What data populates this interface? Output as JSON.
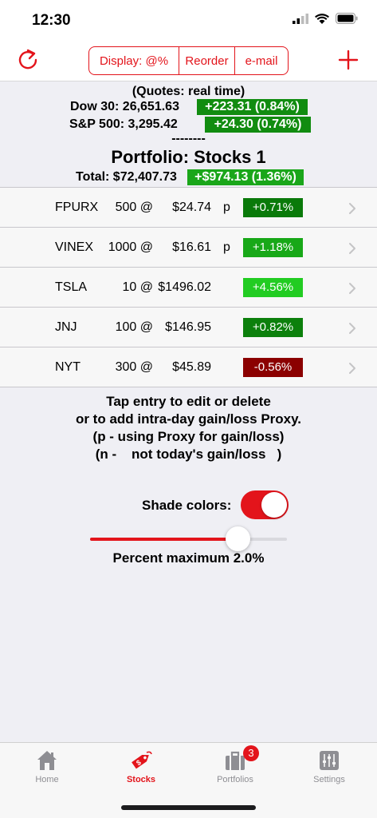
{
  "status": {
    "time": "12:30"
  },
  "nav": {
    "seg": [
      "Display: @%",
      "Reorder",
      "e-mail"
    ]
  },
  "colors": {
    "accent": "#e3141b",
    "green": "#118c10",
    "dark_green": "#0a7a0a",
    "bright_green": "#22cc22",
    "dark_red": "#8b0000"
  },
  "header": {
    "quotes": "(Quotes: real time)",
    "dow_label": "Dow 30: 26,651.63",
    "dow_change": "+223.31 (0.84%)",
    "sp_label": "S&P 500: 3,295.42",
    "sp_change": "+24.30 (0.74%)",
    "divider": "--------",
    "portfolio": "Portfolio: Stocks 1",
    "total_label": "Total: $72,407.73",
    "total_change": "+$974.13 (1.36%)"
  },
  "rows": [
    {
      "sym": "FPURX",
      "qty": "500 @",
      "price": "$24.74",
      "flag": "p",
      "pct": "+0.71%",
      "color": "#0a7a0a"
    },
    {
      "sym": "VINEX",
      "qty": "1000 @",
      "price": "$16.61",
      "flag": "p",
      "pct": "+1.18%",
      "color": "#18a818"
    },
    {
      "sym": "TSLA",
      "qty": "10 @",
      "price": "$1496.02",
      "flag": "",
      "pct": "+4.56%",
      "color": "#22cc22"
    },
    {
      "sym": "JNJ",
      "qty": "100 @",
      "price": "$146.95",
      "flag": "",
      "pct": "+0.82%",
      "color": "#0c800c"
    },
    {
      "sym": "NYT",
      "qty": "300 @",
      "price": "$45.89",
      "flag": "",
      "pct": "-0.56%",
      "color": "#8b0000"
    }
  ],
  "help": [
    "Tap entry to edit or delete",
    "or to add intra-day gain/loss Proxy.",
    "(p - using Proxy for gain/loss)",
    "(n -    not today's gain/loss   )"
  ],
  "shade": {
    "label": "Shade colors:",
    "on": true
  },
  "slider": {
    "value": 0.75,
    "label": "Percent maximum 2.0%"
  },
  "tabs": [
    {
      "label": "Home",
      "icon": "home-icon"
    },
    {
      "label": "Stocks",
      "icon": "tag-icon",
      "active": true
    },
    {
      "label": "Portfolios",
      "icon": "briefcase-icon",
      "badge": "3"
    },
    {
      "label": "Settings",
      "icon": "sliders-icon"
    }
  ]
}
